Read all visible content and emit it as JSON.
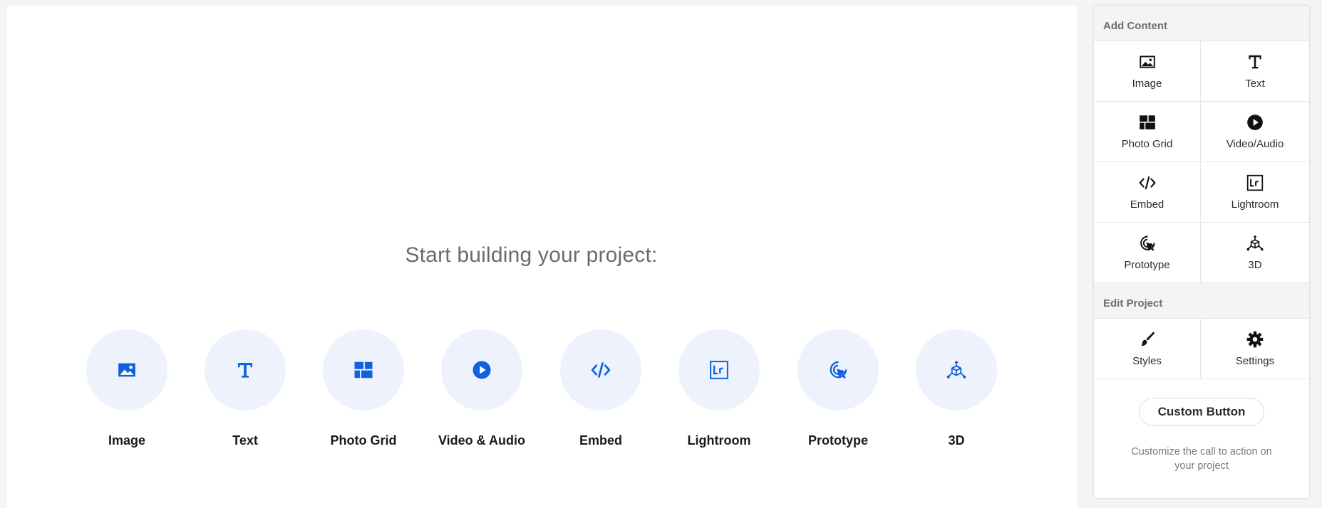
{
  "canvas": {
    "heading": "Start building your project:",
    "accent_color": "#1060e0",
    "tiles": [
      {
        "label": "Image",
        "icon": "image-icon"
      },
      {
        "label": "Text",
        "icon": "text-icon"
      },
      {
        "label": "Photo Grid",
        "icon": "photo-grid-icon"
      },
      {
        "label": "Video & Audio",
        "icon": "play-icon"
      },
      {
        "label": "Embed",
        "icon": "code-icon"
      },
      {
        "label": "Lightroom",
        "icon": "lightroom-icon"
      },
      {
        "label": "Prototype",
        "icon": "cursor-click-icon"
      },
      {
        "label": "3D",
        "icon": "cube-3d-icon"
      }
    ]
  },
  "sidebar": {
    "add_content": {
      "header": "Add Content",
      "items": [
        {
          "label": "Image",
          "icon": "image-icon"
        },
        {
          "label": "Text",
          "icon": "text-icon"
        },
        {
          "label": "Photo Grid",
          "icon": "photo-grid-icon"
        },
        {
          "label": "Video/Audio",
          "icon": "play-icon"
        },
        {
          "label": "Embed",
          "icon": "code-icon"
        },
        {
          "label": "Lightroom",
          "icon": "lightroom-icon"
        },
        {
          "label": "Prototype",
          "icon": "cursor-click-icon"
        },
        {
          "label": "3D",
          "icon": "cube-3d-icon"
        }
      ]
    },
    "edit_project": {
      "header": "Edit Project",
      "items": [
        {
          "label": "Styles",
          "icon": "brush-icon"
        },
        {
          "label": "Settings",
          "icon": "gear-icon"
        }
      ]
    },
    "custom_button": {
      "label": "Custom Button",
      "description": "Customize the call to action on your project"
    }
  }
}
